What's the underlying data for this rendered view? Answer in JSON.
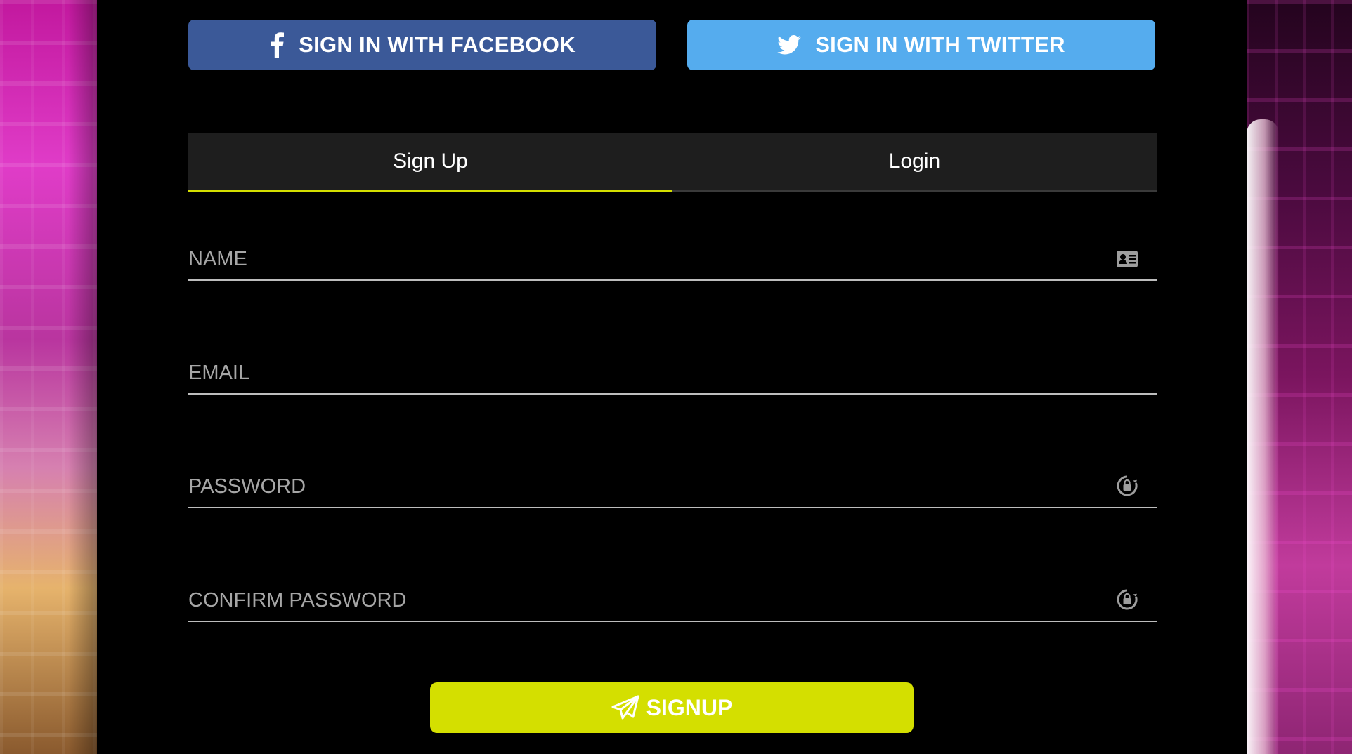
{
  "social": {
    "facebook_label": "SIGN IN WITH FACEBOOK",
    "twitter_label": "SIGN IN WITH TWITTER",
    "facebook_icon": "facebook-icon",
    "twitter_icon": "twitter-icon",
    "facebook_color": "#3b5998",
    "twitter_color": "#55acee"
  },
  "tabs": [
    {
      "label": "Sign Up",
      "active": true
    },
    {
      "label": "Login",
      "active": false
    }
  ],
  "form": {
    "name": {
      "placeholder": "NAME",
      "value": "",
      "icon": "id-card-icon"
    },
    "email": {
      "placeholder": "EMAIL",
      "value": ""
    },
    "password": {
      "placeholder": "PASSWORD",
      "value": "",
      "icon": "lock-icon"
    },
    "confirm_password": {
      "placeholder": "CONFIRM PASSWORD",
      "value": "",
      "icon": "lock-icon"
    }
  },
  "submit": {
    "label": "SIGNUP",
    "icon": "paper-plane-icon"
  },
  "colors": {
    "accent": "#d4df00",
    "tab_bar": "#1e1e1e",
    "background": "#000000",
    "field_line": "#bdbdbd"
  }
}
